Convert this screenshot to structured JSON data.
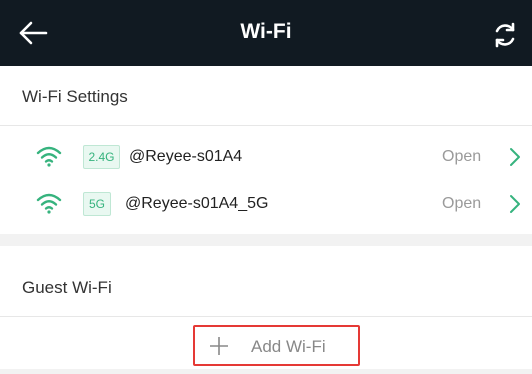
{
  "header": {
    "title": "Wi-Fi",
    "back_icon": "arrow-left-icon",
    "refresh_icon": "refresh-icon"
  },
  "wifi_settings": {
    "heading": "Wi-Fi Settings",
    "networks": [
      {
        "band": "2.4G",
        "ssid": "@Reyee-s01A4",
        "status": "Open",
        "icon": "wifi-icon"
      },
      {
        "band": "5G",
        "ssid": "@Reyee-s01A4_5G",
        "status": "Open",
        "icon": "wifi-icon"
      }
    ]
  },
  "guest_wifi": {
    "heading": "Guest Wi-Fi",
    "add_label": "Add Wi-Fi",
    "add_icon": "plus-icon"
  },
  "colors": {
    "topbar": "#111a22",
    "accent_green": "#36b37e",
    "highlight_red": "#e53935"
  }
}
